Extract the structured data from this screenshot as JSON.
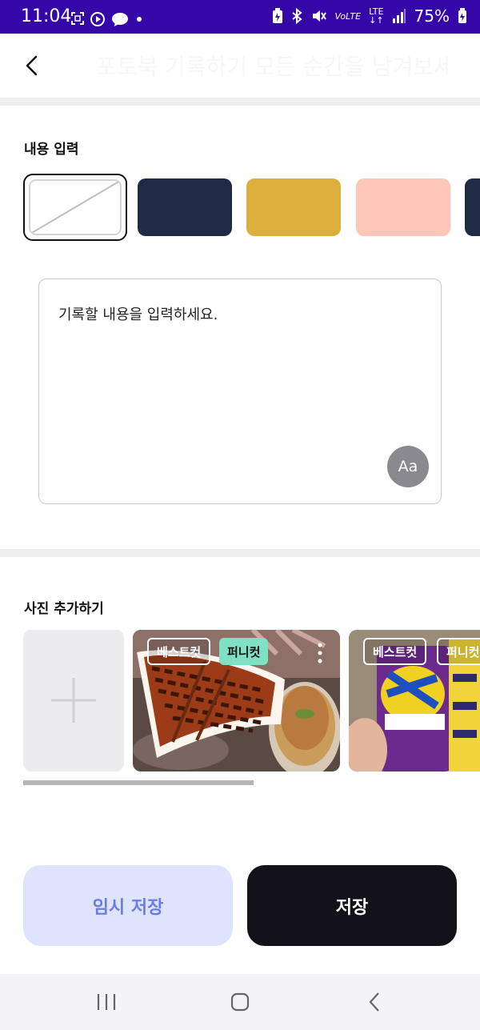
{
  "status_bar": {
    "time": "11:04",
    "battery": "75%",
    "icons": [
      "screenshot-icon",
      "media-icon",
      "message-icon",
      "dot-icon",
      "battery-saver-icon",
      "bluetooth-icon",
      "mute-icon",
      "volte-icon",
      "lte-icon",
      "signal-icon",
      "battery-icon"
    ],
    "network_label": "LTE",
    "volte_label": "VoLTE",
    "background": "#3607a8"
  },
  "header": {
    "back_icon": "chevron-left-icon",
    "title": "포토북 기록하기 모든 순간을 남겨보세요"
  },
  "content_section": {
    "label": "내용 입력",
    "swatches": [
      {
        "name": "none",
        "color": "#ffffff",
        "selected": true
      },
      {
        "name": "navy",
        "color": "#1f2a44"
      },
      {
        "name": "mustard",
        "color": "#dcaf3d"
      },
      {
        "name": "peach",
        "color": "#fec6b8"
      },
      {
        "name": "dark-navy",
        "color": "#1f2a44"
      }
    ],
    "placeholder": "기록할 내용을 입력하세요.",
    "font_button_label": "Aa"
  },
  "photo_section": {
    "label": "사진 추가하기",
    "add_icon": "plus-icon",
    "photos": [
      {
        "subject": "food",
        "tags": [
          "베스트컷",
          "퍼니컷"
        ]
      },
      {
        "subject": "drinks",
        "tags": [
          "베스트컷",
          "퍼니컷"
        ]
      }
    ],
    "more_icon": "more-vertical-icon"
  },
  "actions": {
    "temp_save": "임시 저장",
    "save": "저장"
  },
  "nav_bar": {
    "icons": [
      "recents-icon",
      "home-icon",
      "back-icon"
    ]
  }
}
